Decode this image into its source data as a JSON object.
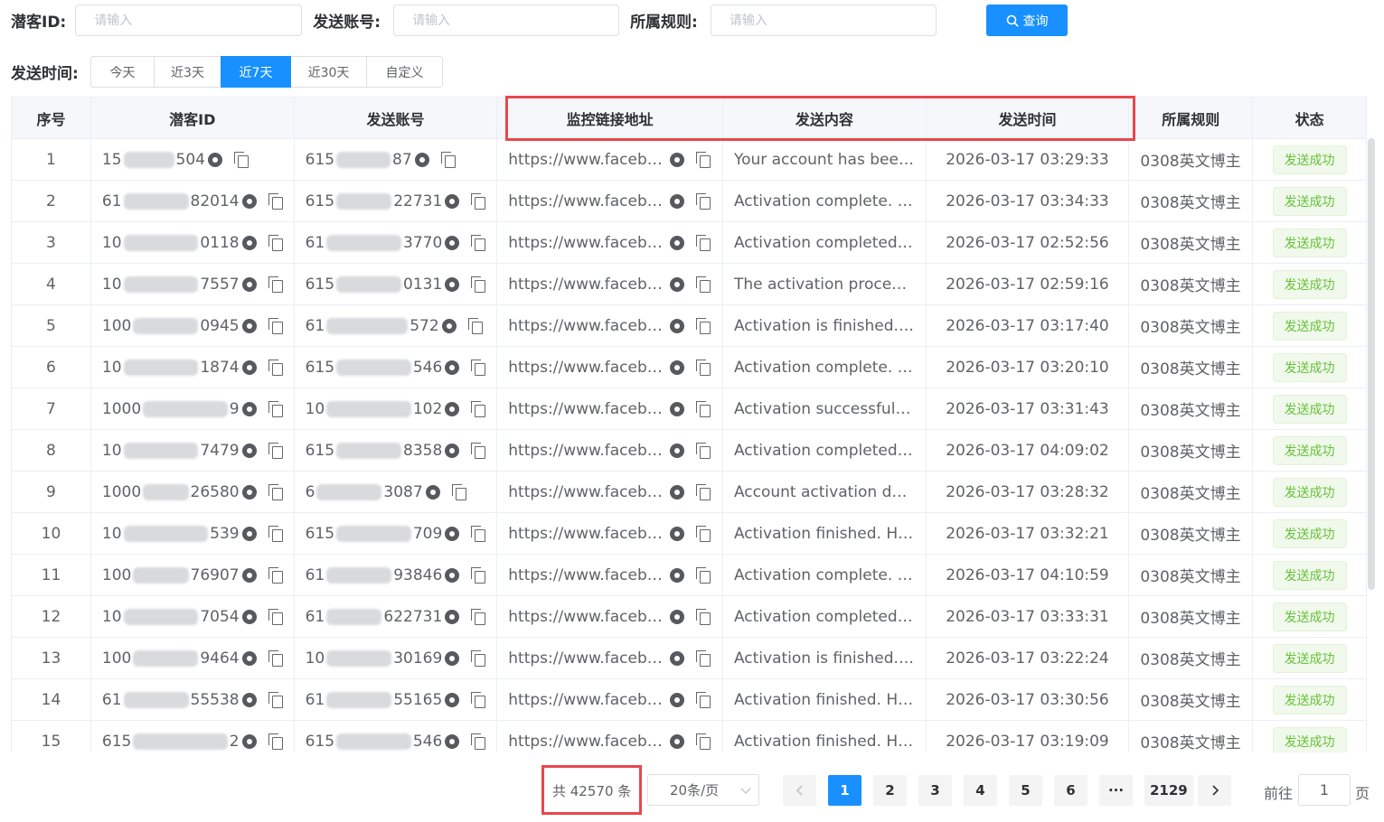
{
  "filters": {
    "lead_id_label": "潜客ID:",
    "lead_id_placeholder": "请输入",
    "sender_label": "发送账号:",
    "sender_placeholder": "请输入",
    "rule_label": "所属规则:",
    "rule_placeholder": "请输入",
    "query_label": "查询",
    "time_label": "发送时间:",
    "time_ranges": [
      "今天",
      "近3天",
      "近7天",
      "近30天",
      "自定义"
    ],
    "active_range": "近7天"
  },
  "table": {
    "columns": [
      "序号",
      "潜客ID",
      "发送账号",
      "监控链接地址",
      "发送内容",
      "发送时间",
      "所属规则",
      "状态"
    ],
    "rows": [
      {
        "no": "1",
        "lead_a": "15",
        "lead_b": "504",
        "send_a": "615",
        "send_b": "87",
        "link": "https://www.facebook.com/",
        "content": "Your account has been activated.",
        "time": "2026-03-17 03:29:33",
        "rule": "0308英文博主",
        "status": "发送成功"
      },
      {
        "no": "2",
        "lead_a": "61",
        "lead_b": "82014",
        "send_a": "615",
        "send_b": "22731",
        "link": "https://www.facebook.com/",
        "content": "Activation complete. Your account",
        "time": "2026-03-17 03:34:33",
        "rule": "0308英文博主",
        "status": "发送成功"
      },
      {
        "no": "3",
        "lead_a": "10",
        "lead_b": "0118",
        "send_a": "61",
        "send_b": "3770",
        "link": "https://www.facebook.com/",
        "content": "Activation completed. Your",
        "time": "2026-03-17 02:52:56",
        "rule": "0308英文博主",
        "status": "发送成功"
      },
      {
        "no": "4",
        "lead_a": "10",
        "lead_b": "7557",
        "send_a": "615",
        "send_b": "0131",
        "link": "https://www.facebook.com/",
        "content": "The activation process is done",
        "time": "2026-03-17 02:59:16",
        "rule": "0308英文博主",
        "status": "发送成功"
      },
      {
        "no": "5",
        "lead_a": "100",
        "lead_b": "0945",
        "send_a": "61",
        "send_b": "572",
        "link": "https://www.facebook.com/",
        "content": "Activation is finished. Your",
        "time": "2026-03-17 03:17:40",
        "rule": "0308英文博主",
        "status": "发送成功"
      },
      {
        "no": "6",
        "lead_a": "10",
        "lead_b": "1874",
        "send_a": "615",
        "send_b": "546",
        "link": "https://www.facebook.com/",
        "content": "Activation complete. Your account",
        "time": "2026-03-17 03:20:10",
        "rule": "0308英文博主",
        "status": "发送成功"
      },
      {
        "no": "7",
        "lead_a": "1000",
        "lead_b": "9",
        "send_a": "10",
        "send_b": "102",
        "link": "https://www.facebook.com/",
        "content": "Activation successful. Your",
        "time": "2026-03-17 03:31:43",
        "rule": "0308英文博主",
        "status": "发送成功"
      },
      {
        "no": "8",
        "lead_a": "10",
        "lead_b": "7479",
        "send_a": "615",
        "send_b": "8358",
        "link": "https://www.facebook.com/",
        "content": "Activation completed. Your",
        "time": "2026-03-17 04:09:02",
        "rule": "0308英文博主",
        "status": "发送成功"
      },
      {
        "no": "9",
        "lead_a": "1000",
        "lead_b": "26580",
        "send_a": "6",
        "send_b": "3087",
        "link": "https://www.facebook.com/",
        "content": "Account activation done. Your",
        "time": "2026-03-17 03:28:32",
        "rule": "0308英文博主",
        "status": "发送成功"
      },
      {
        "no": "10",
        "lead_a": "10",
        "lead_b": "539",
        "send_a": "615",
        "send_b": "709",
        "link": "https://www.facebook.com/",
        "content": "Activation finished. Here is",
        "time": "2026-03-17 03:32:21",
        "rule": "0308英文博主",
        "status": "发送成功"
      },
      {
        "no": "11",
        "lead_a": "100",
        "lead_b": "76907",
        "send_a": "61",
        "send_b": "93846",
        "link": "https://www.facebook.com/",
        "content": "Activation complete. Your account",
        "time": "2026-03-17 04:10:59",
        "rule": "0308英文博主",
        "status": "发送成功"
      },
      {
        "no": "12",
        "lead_a": "10",
        "lead_b": "7054",
        "send_a": "61",
        "send_b": "622731",
        "link": "https://www.facebook.com/",
        "content": "Activation completed. Your",
        "time": "2026-03-17 03:33:31",
        "rule": "0308英文博主",
        "status": "发送成功"
      },
      {
        "no": "13",
        "lead_a": "100",
        "lead_b": "9464",
        "send_a": "10",
        "send_b": "30169",
        "link": "https://www.facebook.com/",
        "content": "Activation is finished. Your",
        "time": "2026-03-17 03:22:24",
        "rule": "0308英文博主",
        "status": "发送成功"
      },
      {
        "no": "14",
        "lead_a": "61",
        "lead_b": "55538",
        "send_a": "61",
        "send_b": "55165",
        "link": "https://www.facebook.com/",
        "content": "Activation finished. Here is",
        "time": "2026-03-17 03:30:56",
        "rule": "0308英文博主",
        "status": "发送成功"
      },
      {
        "no": "15",
        "lead_a": "615",
        "lead_b": "2",
        "send_a": "615",
        "send_b": "546",
        "link": "https://www.facebook.com/",
        "content": "Activation finished. Here is",
        "time": "2026-03-17 03:19:09",
        "rule": "0308英文博主",
        "status": "发送成功"
      }
    ]
  },
  "pagination": {
    "total_label": "共 42570 条",
    "page_size": "20条/页",
    "pages": [
      "1",
      "2",
      "3",
      "4",
      "5",
      "6"
    ],
    "ellipsis": "···",
    "last_page": "2129",
    "current_page": "1",
    "goto_prefix": "前往",
    "goto_value": "1",
    "goto_suffix": "页"
  },
  "colors": {
    "accent": "#1890ff",
    "highlight_box": "#e8474c",
    "status_text": "#67c23a",
    "status_bg": "#f0f9eb"
  }
}
